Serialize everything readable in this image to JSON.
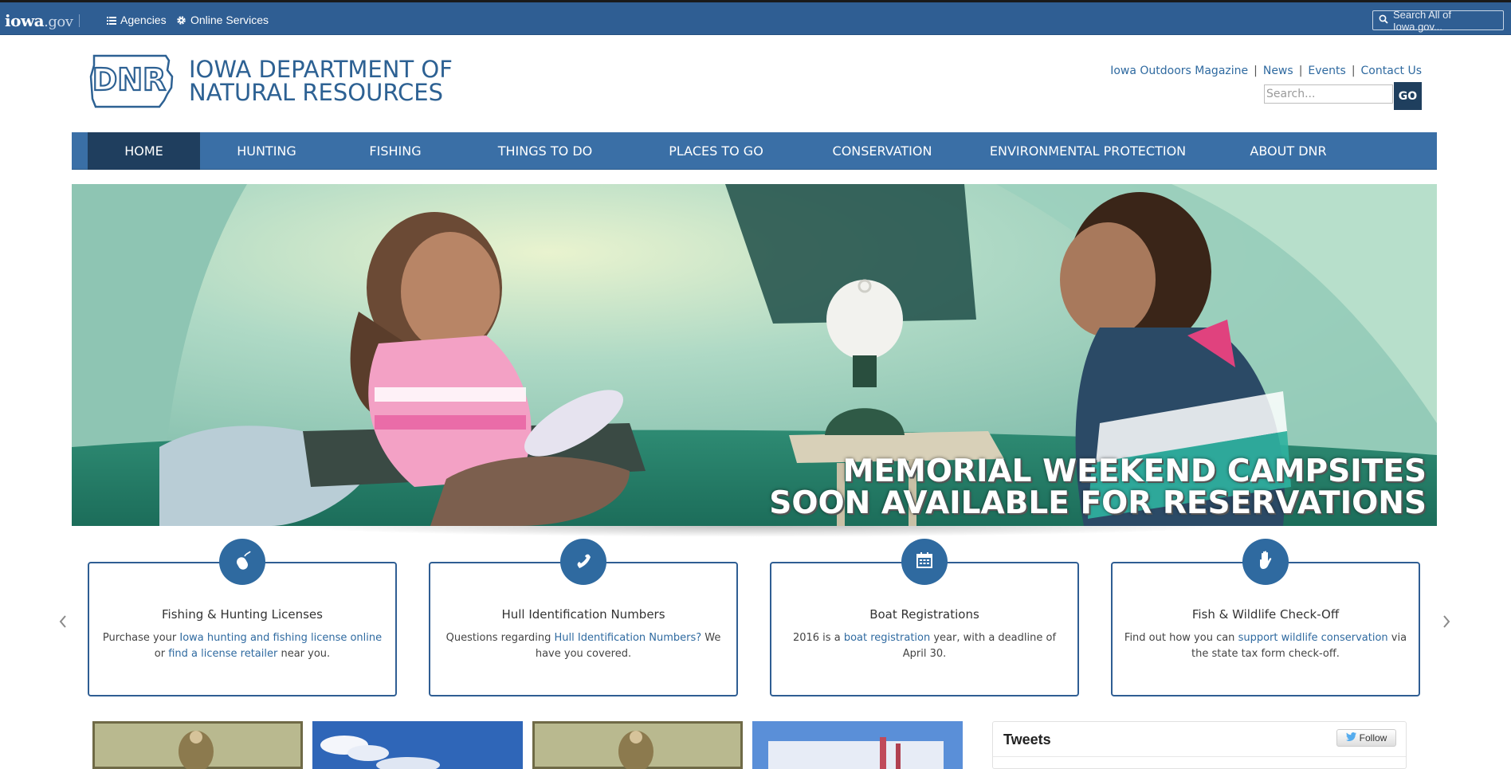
{
  "gov_bar": {
    "logo_main": "iowa",
    "logo_suffix": ".gov",
    "agencies_label": "Agencies",
    "online_services_label": "Online Services",
    "search_placeholder": "Search All of Iowa.gov..."
  },
  "header": {
    "logo_text": "DNR",
    "title_line1": "IOWA DEPARTMENT OF",
    "title_line2": "NATURAL RESOURCES",
    "util_links": [
      "Iowa Outdoors Magazine",
      "News",
      "Events",
      "Contact Us"
    ],
    "search_placeholder": "Search...",
    "go_label": "GO"
  },
  "nav": {
    "items": [
      "HOME",
      "HUNTING",
      "FISHING",
      "THINGS TO DO",
      "PLACES TO GO",
      "CONSERVATION",
      "ENVIRONMENTAL PROTECTION",
      "ABOUT DNR"
    ],
    "active": "HOME"
  },
  "hero": {
    "caption_line1": "MEMORIAL WEEKEND CAMPSITES",
    "caption_line2": "SOON AVAILABLE FOR RESERVATIONS"
  },
  "cards": [
    {
      "icon": "mouse-icon",
      "title": "Fishing & Hunting Licenses",
      "text_parts": [
        "Purchase your ",
        "Iowa hunting and fishing license online",
        " or ",
        "find a license retailer",
        " near you."
      ]
    },
    {
      "icon": "phone-icon",
      "title": "Hull Identification Numbers",
      "text_parts": [
        "Questions regarding ",
        "Hull Identification Numbers?",
        " We have you covered."
      ]
    },
    {
      "icon": "calendar-icon",
      "title": "Boat Registrations",
      "text_parts": [
        "2016 is a ",
        "boat registration",
        " year, with a deadline of April 30."
      ]
    },
    {
      "icon": "hand-icon",
      "title": "Fish & Wildlife Check-Off",
      "text_parts": [
        "Find out how you can ",
        "support wildlife conservation",
        " via the state tax form check-off."
      ]
    }
  ],
  "tweets": {
    "title": "Tweets",
    "follow_label": "Follow"
  },
  "colors": {
    "gov_bar": "#2f5e93",
    "nav": "#3a6fa6",
    "nav_active": "#1f3e5e",
    "link": "#2f6aa0"
  }
}
